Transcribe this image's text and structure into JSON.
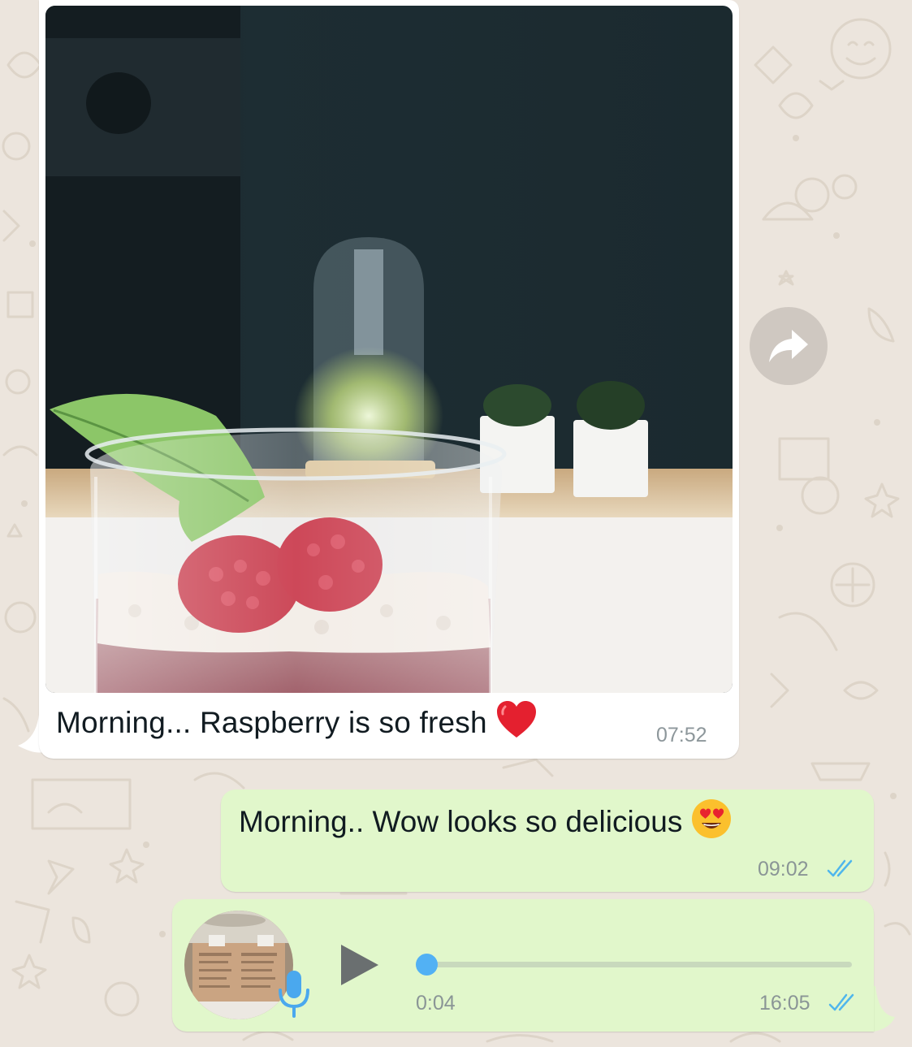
{
  "messages": [
    {
      "direction": "incoming",
      "type": "image",
      "caption": "Morning... Raspberry is so fresh",
      "emoji": "red-heart",
      "time": "07:52"
    },
    {
      "direction": "outgoing",
      "type": "text",
      "text": "Morning.. Wow looks so delicious",
      "emoji": "smiling-face-with-heart-eyes",
      "time": "09:02",
      "status": "read"
    },
    {
      "direction": "outgoing",
      "type": "voice",
      "duration": "0:04",
      "progress": 0,
      "time": "16:05",
      "status": "read"
    }
  ],
  "icons": {
    "forward": "forward-arrow-icon",
    "play": "play-icon",
    "mic": "microphone-icon",
    "ticks": "double-check-icon"
  },
  "colors": {
    "wallpaper": "#ece5dd",
    "incoming_bubble": "#ffffff",
    "outgoing_bubble": "#e1f7cb",
    "read_ticks": "#4fb6ec",
    "progress_dot": "#52b1f4",
    "mic": "#4aa8ee"
  }
}
